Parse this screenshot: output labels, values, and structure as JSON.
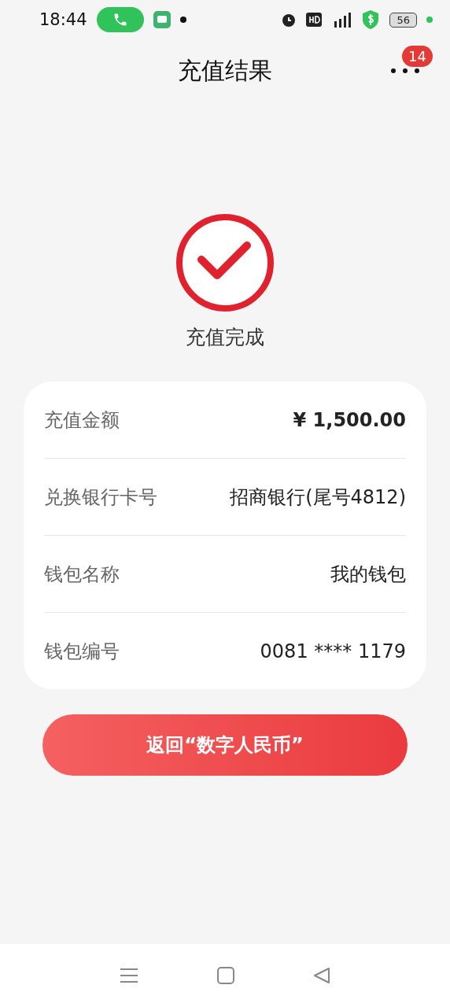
{
  "status_bar": {
    "time": "18:44",
    "battery": "56"
  },
  "nav_bar": {
    "title": "充值结果",
    "badge": "14"
  },
  "result": {
    "status": "充值完成"
  },
  "details": [
    {
      "label": "充值金额",
      "value": "¥ 1,500.00",
      "emphasized": true
    },
    {
      "label": "兑换银行卡号",
      "value": "招商银行(尾号4812)",
      "emphasized": false
    },
    {
      "label": "钱包名称",
      "value": "我的钱包",
      "emphasized": false
    },
    {
      "label": "钱包编号",
      "value": "0081 **** 1179",
      "emphasized": false
    }
  ],
  "return_button": {
    "label": "返回“数字人民币”"
  }
}
